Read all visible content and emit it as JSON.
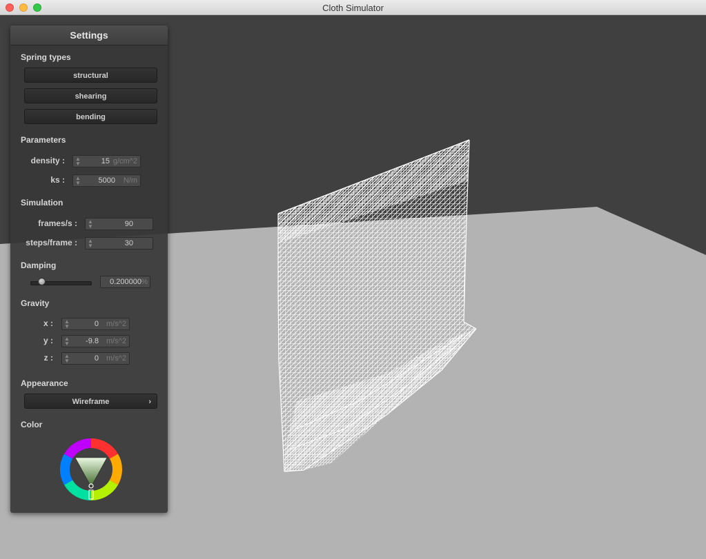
{
  "window": {
    "title": "Cloth Simulator"
  },
  "settings": {
    "header": "Settings",
    "spring_types": {
      "title": "Spring types",
      "buttons": [
        "structural",
        "shearing",
        "bending"
      ]
    },
    "parameters": {
      "title": "Parameters",
      "density": {
        "label": "density :",
        "value": "15",
        "unit": "g/cm^2"
      },
      "ks": {
        "label": "ks :",
        "value": "5000",
        "unit": "N/m"
      }
    },
    "simulation": {
      "title": "Simulation",
      "frames": {
        "label": "frames/s :",
        "value": "90"
      },
      "steps": {
        "label": "steps/frame :",
        "value": "30"
      }
    },
    "damping": {
      "title": "Damping",
      "value": "0.200000",
      "unit": "%",
      "slider_fraction": 0.2
    },
    "gravity": {
      "title": "Gravity",
      "x": {
        "label": "x :",
        "value": "0",
        "unit": "m/s^2"
      },
      "y": {
        "label": "y :",
        "value": "-9.8",
        "unit": "m/s^2"
      },
      "z": {
        "label": "z :",
        "value": "0",
        "unit": "m/s^2"
      }
    },
    "appearance": {
      "title": "Appearance",
      "selected": "Wireframe",
      "chevron": "›"
    },
    "color": {
      "title": "Color",
      "current": "#8bd36a"
    }
  },
  "scene": {
    "background_color": "#404040",
    "floor_color": "#b3b3b3",
    "cloth_color": "#ffffff",
    "render_mode": "Wireframe"
  }
}
